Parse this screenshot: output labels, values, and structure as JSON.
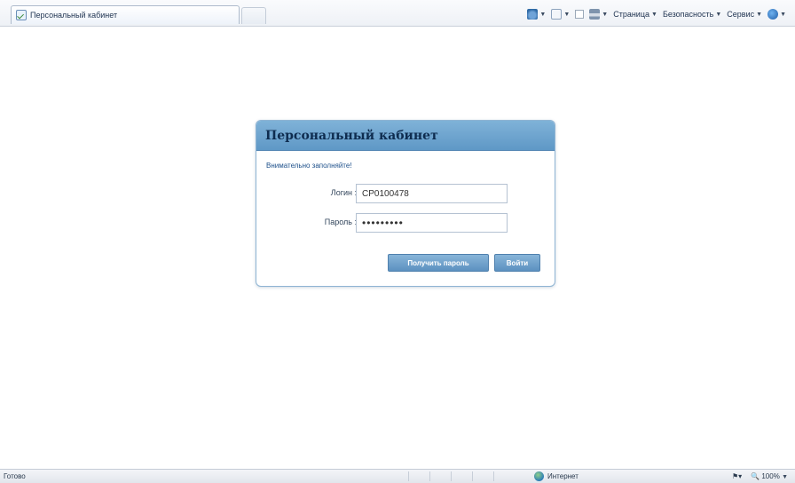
{
  "browser": {
    "tab_title": "Персональный кабинет",
    "commands": {
      "page_label": "Страница",
      "safety_label": "Безопасность",
      "tools_label": "Сервис"
    },
    "icons": [
      "home-icon",
      "feeds-icon",
      "mail-icon",
      "print-icon",
      "help-icon"
    ]
  },
  "panel": {
    "title": "Персональный кабинет",
    "attention_text": "Внимательно заполняйте!",
    "login_label": "Логин :",
    "login_value": "CP0100478",
    "password_label": "Пароль :",
    "password_value": "•••••••••",
    "recover_button": "Получить пароль",
    "login_button": "Войти"
  },
  "statusbar": {
    "status_text": "Готово",
    "zone_text": "Интернет",
    "zoom_text": "100%"
  },
  "colors": {
    "panel_header": "#6ea6d0",
    "panel_border": "#8fb4d3",
    "button": "#6e9fcb",
    "link_text": "#1c4f8a"
  }
}
